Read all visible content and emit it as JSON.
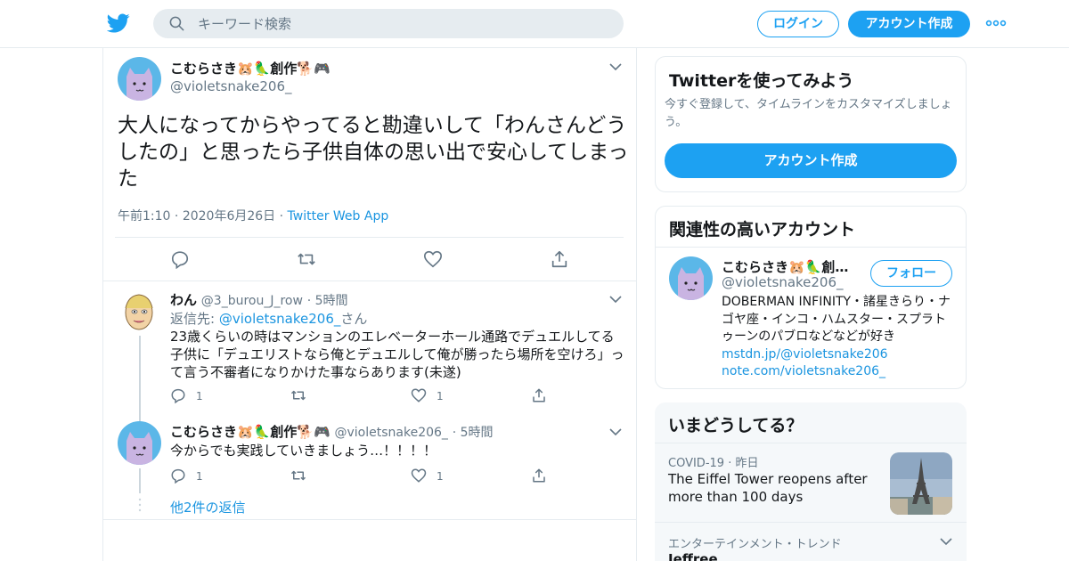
{
  "header": {
    "search_placeholder": "キーワード検索",
    "login_label": "ログイン",
    "signup_label": "アカウント作成",
    "icons": {
      "logo": "twitter-bird-icon",
      "search": "search-icon",
      "more": "more-icon"
    },
    "brand_color": "#1da1f2"
  },
  "tweet": {
    "name": "こむらさき🐹🦜創作🐕🎮",
    "handle": "@violetsnake206_",
    "text": "大人になってからやってると勘違いして「わんさんどうしたの」と思ったら子供自体の思い出で安心してしまった",
    "time": "午前1:10",
    "date": "2020年6月26日",
    "source": "Twitter Web App",
    "actions": [
      "reply-icon",
      "retweet-icon",
      "like-icon",
      "share-icon"
    ]
  },
  "replies": [
    {
      "name": "わん",
      "handle": "@3_burou_J_row",
      "time": "5時間",
      "reply_to_prefix": "返信先:",
      "reply_to_handle": "@violetsnake206_",
      "reply_to_suffix": "さん",
      "text": "23歳くらいの時はマンションのエレベーターホール通路でデュエルしてる子供に「デュエリストなら俺とデュエルして俺が勝ったら場所を空けろ」って言う不審者になりかけた事ならあります(未遂)",
      "reply_count": "1",
      "retweet_count": "",
      "like_count": "1"
    },
    {
      "name": "こむらさき🐹🦜創作🐕🎮",
      "handle": "@violetsnake206_",
      "time": "5時間",
      "text": "今からでも実践していきましょう…！！！！",
      "reply_count": "1",
      "retweet_count": "",
      "like_count": "1"
    }
  ],
  "more_replies": "他2件の返信",
  "sidebar": {
    "promo": {
      "title": "Twitterを使ってみよう",
      "desc": "今すぐ登録して、タイムラインをカスタマイズしましょう。",
      "button": "アカウント作成"
    },
    "related": {
      "title": "関連性の高いアカウント",
      "name": "こむらさき🐹🦜創…",
      "handle": "@violetsnake206_",
      "follow": "フォロー",
      "bio": "DOBERMAN INFINITY・諸星きらり・ナゴヤ座・インコ・ハムスター・スプラトゥーンのパブロなどなどが好き",
      "link1": "mstdn.jp/@violetsnake206",
      "link2": "note.com/violetsnake206_"
    },
    "trends": {
      "title": "いまどうしてる？",
      "items": [
        {
          "category": "COVID-19",
          "time": "昨日",
          "title": "The Eiffel Tower reopens after more than 100 days"
        },
        {
          "category": "エンターテインメント・トレンド",
          "title": "Jeffree"
        }
      ]
    }
  }
}
